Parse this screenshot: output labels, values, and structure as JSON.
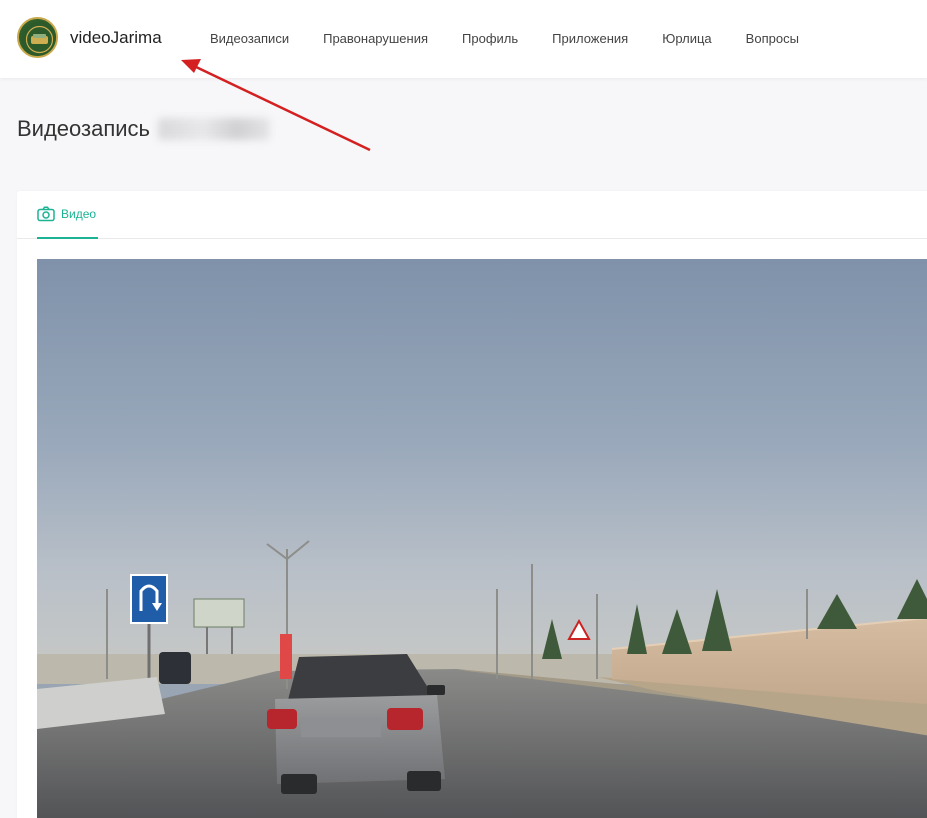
{
  "header": {
    "brand": "videoJarima",
    "nav": [
      {
        "label": "Видеозаписи"
      },
      {
        "label": "Правонарушения"
      },
      {
        "label": "Профиль"
      },
      {
        "label": "Приложения"
      },
      {
        "label": "Юрлица"
      },
      {
        "label": "Вопросы"
      }
    ]
  },
  "page": {
    "title": "Видеозапись"
  },
  "tabs": [
    {
      "label": "Видео",
      "icon": "camera-icon",
      "active": true
    }
  ],
  "colors": {
    "accent": "#1bb394",
    "annotation": "#d42020"
  }
}
